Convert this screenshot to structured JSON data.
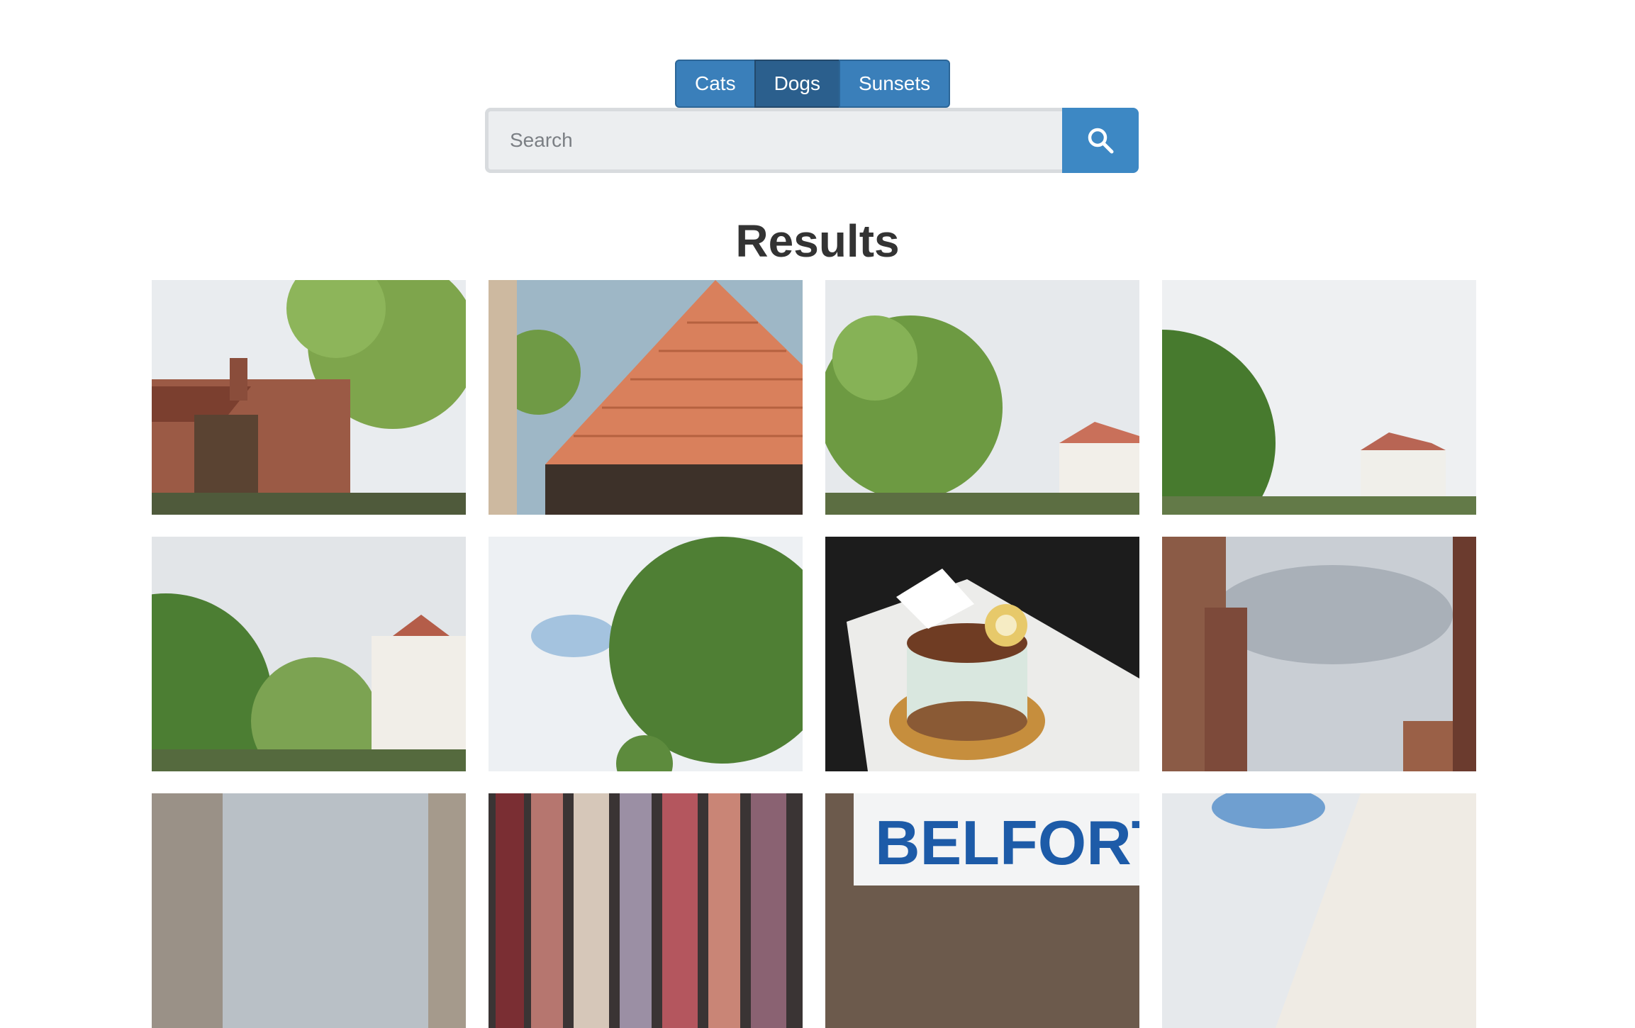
{
  "tabs": [
    {
      "label": "Cats",
      "active": false
    },
    {
      "label": "Dogs",
      "active": true
    },
    {
      "label": "Sunsets",
      "active": false
    }
  ],
  "search": {
    "placeholder": "Search",
    "value": "",
    "icon": "search-icon"
  },
  "results": {
    "title": "Results",
    "sign_text": "BELFORT"
  },
  "colors": {
    "tab": "#3a7fba",
    "tab_active": "#2b5f8d",
    "search_button": "#3d88c4",
    "title": "#333333"
  }
}
